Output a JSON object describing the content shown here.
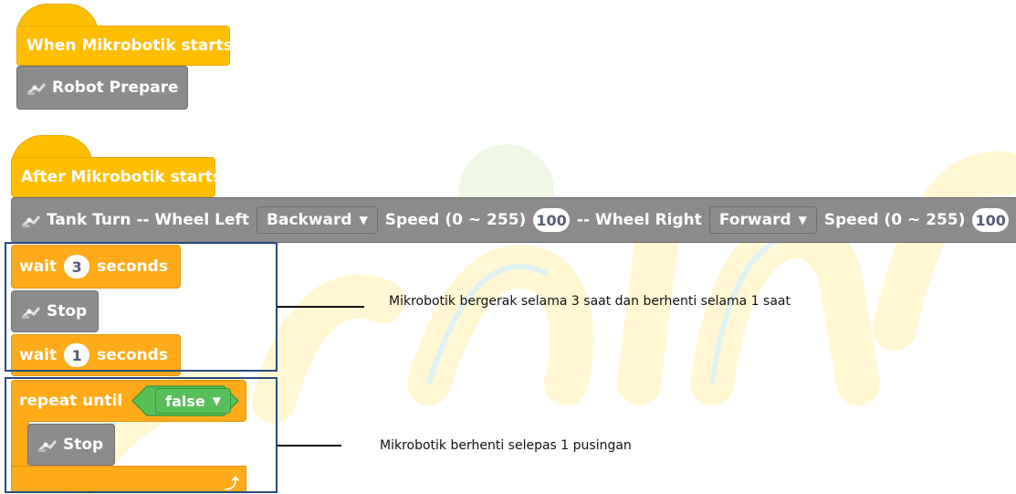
{
  "blocks": {
    "when_start": "When Mikrobotik starts",
    "robot_prepare": "Robot Prepare",
    "after_start": "After Mikrobotik starts",
    "tank_turn": {
      "label": "Tank Turn -- Wheel Left",
      "left_dir": "Backward",
      "speed_label_1": "Speed (0 ~ 255)",
      "left_speed": "100",
      "right_label": "-- Wheel Right",
      "right_dir": "Forward",
      "speed_label_2": "Speed (0 ~ 255)",
      "right_speed": "100"
    },
    "wait1": {
      "prefix": "wait",
      "value": "3",
      "suffix": "seconds"
    },
    "stop1": "Stop",
    "wait2": {
      "prefix": "wait",
      "value": "1",
      "suffix": "seconds"
    },
    "repeat_until": {
      "label": "repeat until",
      "condition": "false"
    },
    "stop2": "Stop"
  },
  "annotations": {
    "note1": "Mikrobotik bergerak selama 3 saat dan berhenti selama 1 saat",
    "note2": "Mikrobotik berhenti selepas 1 pusingan"
  },
  "colors": {
    "event": "#ffbf00",
    "control": "#ffab19",
    "robot": "#8c8c8c",
    "boolean": "#59c059",
    "frame": "#2a4a7f"
  },
  "icons": {
    "robot": "robot-arm-icon",
    "loop": "loop-arrow-icon",
    "dropdown": "caret-down-icon"
  }
}
